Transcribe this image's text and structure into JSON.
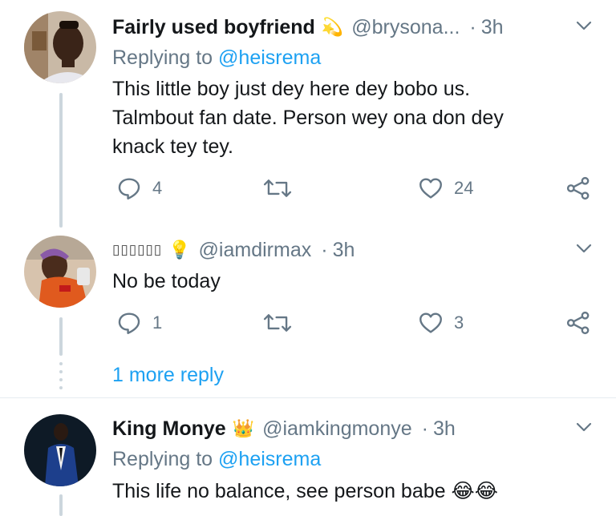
{
  "tweets": [
    {
      "name": "Fairly used boyfriend",
      "badge": "💫",
      "handle": "@brysona...",
      "time": "3h",
      "reply_prefix": "Replying to",
      "reply_mention": "@heisrema",
      "lines": [
        "This little boy just dey here dey bobo us.",
        "Talmbout fan date. Person wey ona don dey",
        "knack tey tey."
      ],
      "replies": "4",
      "likes": "24"
    },
    {
      "name": "▯▯▯▯▯▯",
      "badge": "💡",
      "handle": "@iamdirmax",
      "time": "3h",
      "lines": [
        "No be today"
      ],
      "replies": "1",
      "likes": "3"
    },
    {
      "name": "King Monye",
      "badge": "👑",
      "handle": "@iamkingmonye",
      "time": "3h",
      "reply_prefix": "Replying to",
      "reply_mention": "@heisrema",
      "lines": [
        "This life no balance, see person babe 😂😂"
      ]
    }
  ],
  "more_reply": "1 more reply",
  "colors": {
    "primary_text": "#14171a",
    "secondary_text": "#657786",
    "link": "#1da1f2",
    "thread_line": "#ccd6dd",
    "separator": "#e6ecf0"
  },
  "icons": [
    "reply-icon",
    "retweet-icon",
    "like-icon",
    "share-icon",
    "chevron-down-icon"
  ]
}
